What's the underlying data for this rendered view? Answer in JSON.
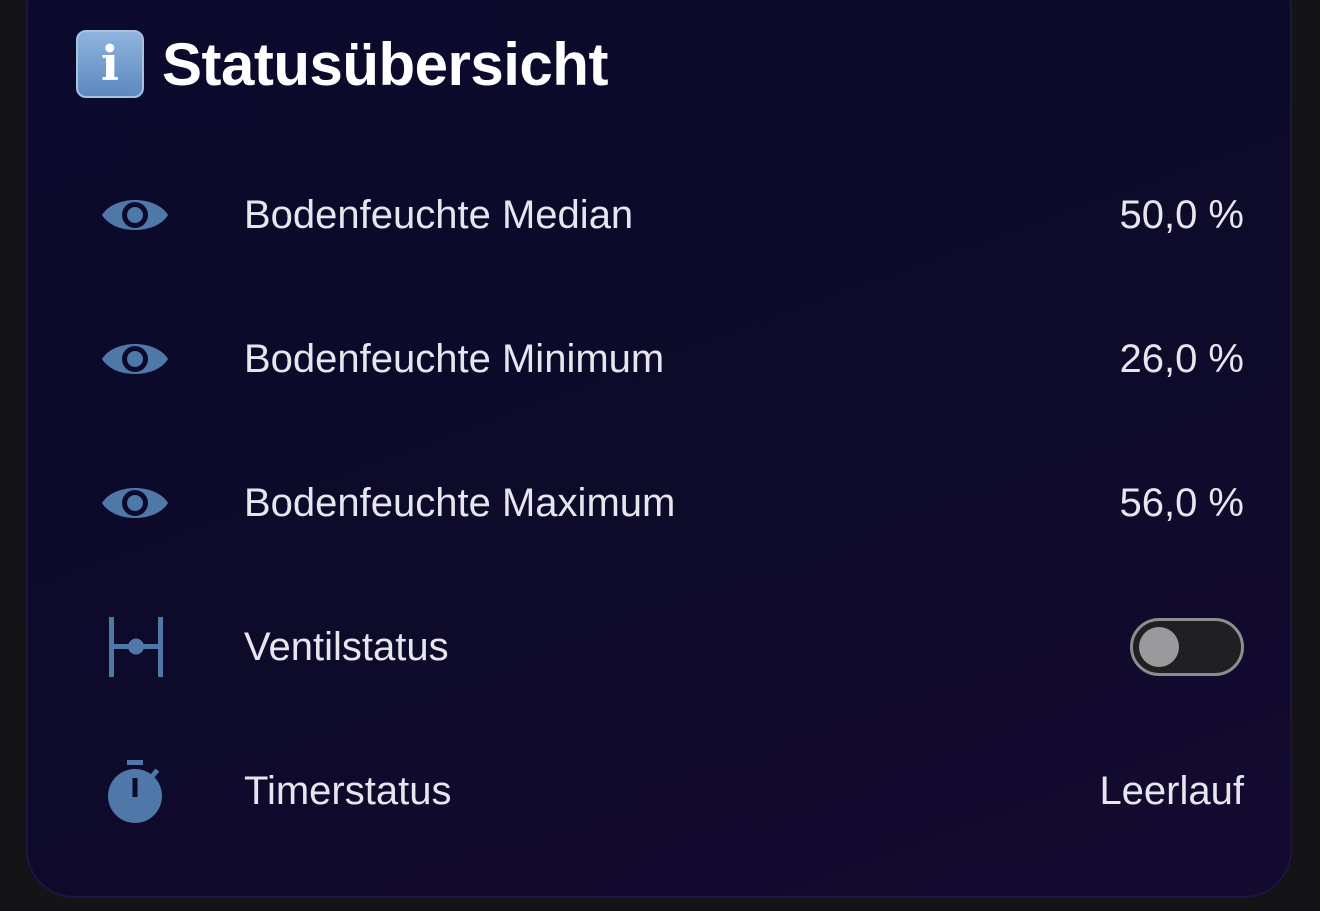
{
  "card": {
    "title": "Statusübersicht",
    "title_icon": "info-icon",
    "rows": [
      {
        "label": "Bodenfeuchte Median",
        "value": "50,0 %",
        "icon": "eye-icon"
      },
      {
        "label": "Bodenfeuchte Minimum",
        "value": "26,0 %",
        "icon": "eye-icon"
      },
      {
        "label": "Bodenfeuchte Maximum",
        "value": "56,0 %",
        "icon": "eye-icon"
      },
      {
        "label": "Ventilstatus",
        "icon": "valve-icon",
        "toggle_on": false
      },
      {
        "label": "Timerstatus",
        "value": "Leerlauf",
        "icon": "timer-icon"
      }
    ]
  },
  "colors": {
    "icon": "#4f77a8",
    "background": "#0b0a2c",
    "text": "#e6e6ee"
  }
}
